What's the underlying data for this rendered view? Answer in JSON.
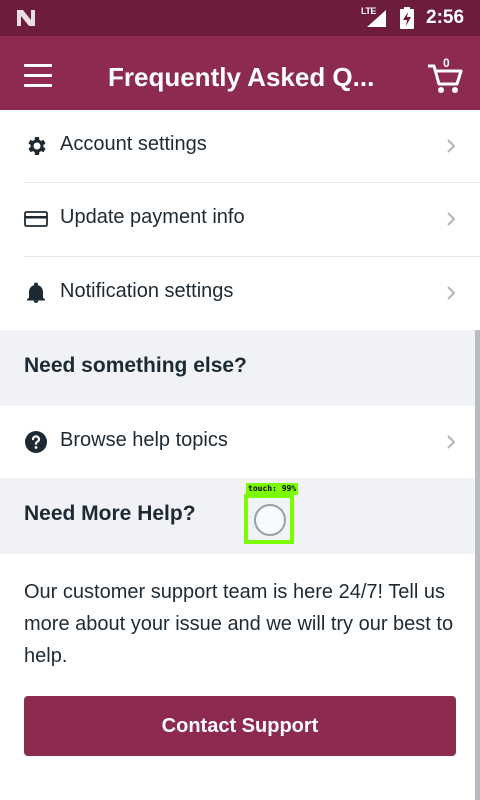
{
  "status_bar": {
    "network": "LTE",
    "time": "2:56"
  },
  "app_bar": {
    "title": "Frequently Asked Q...",
    "cart_count": "0"
  },
  "settings": {
    "items": [
      {
        "label": "Account settings",
        "icon": "gear-icon"
      },
      {
        "label": "Update payment info",
        "icon": "credit-card-icon"
      },
      {
        "label": "Notification settings",
        "icon": "bell-icon"
      }
    ]
  },
  "something_else": {
    "header": "Need something else?",
    "items": [
      {
        "label": "Browse help topics",
        "icon": "question-circle-icon"
      }
    ]
  },
  "more_help": {
    "header": "Need More Help?",
    "body": "Our customer support team is here 24/7! Tell us more about your issue and we will try our best to help.",
    "button": "Contact Support"
  },
  "overlay": {
    "touch_label": "touch: 99%"
  },
  "colors": {
    "status_bar": "#6e1c3c",
    "app_bar": "#8c2a50",
    "button": "#8c2a50",
    "section_bg": "#f0f2f5",
    "touch_overlay": "#7cfc00"
  }
}
